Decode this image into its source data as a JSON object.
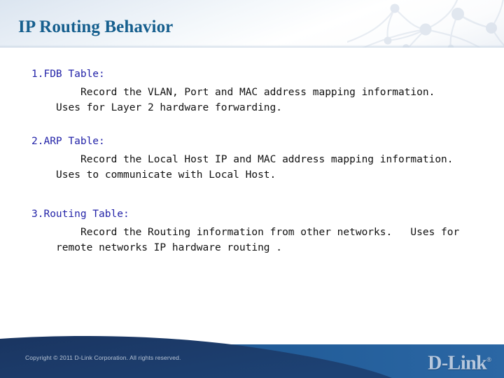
{
  "header": {
    "title": "IP Routing Behavior",
    "watermark_icon": "network-nodes-watermark",
    "title_color": "#165f8e",
    "band_top_color": "#dbe5f0",
    "band_bottom_color": "#ffffff"
  },
  "content": {
    "heading_color": "#2323a8",
    "body_color": "#101010",
    "items": [
      {
        "heading": "1.FDB Table:",
        "line_a": "Record the VLAN, Port and MAC address mapping information.",
        "line_b": "Uses for Layer 2 hardware forwarding."
      },
      {
        "heading": "2.ARP Table:",
        "line_a": "Record the Local Host IP and MAC address mapping information.",
        "line_b": "Uses to communicate with Local Host."
      },
      {
        "heading": "3.Routing Table:",
        "line_a": "Record the Routing information from other networks.   Uses for",
        "line_b": "remote networks IP hardware routing ."
      }
    ]
  },
  "footer": {
    "copyright": "Copyright © 2011 D-Link Corporation. All rights reserved.",
    "logo_text": "D-Link",
    "logo_registered_mark": "®",
    "band_color": "#1d558f",
    "wave_color": "#1b3a66",
    "copyright_color": "#b9c5d6",
    "logo_color": "#b7c8dd"
  }
}
